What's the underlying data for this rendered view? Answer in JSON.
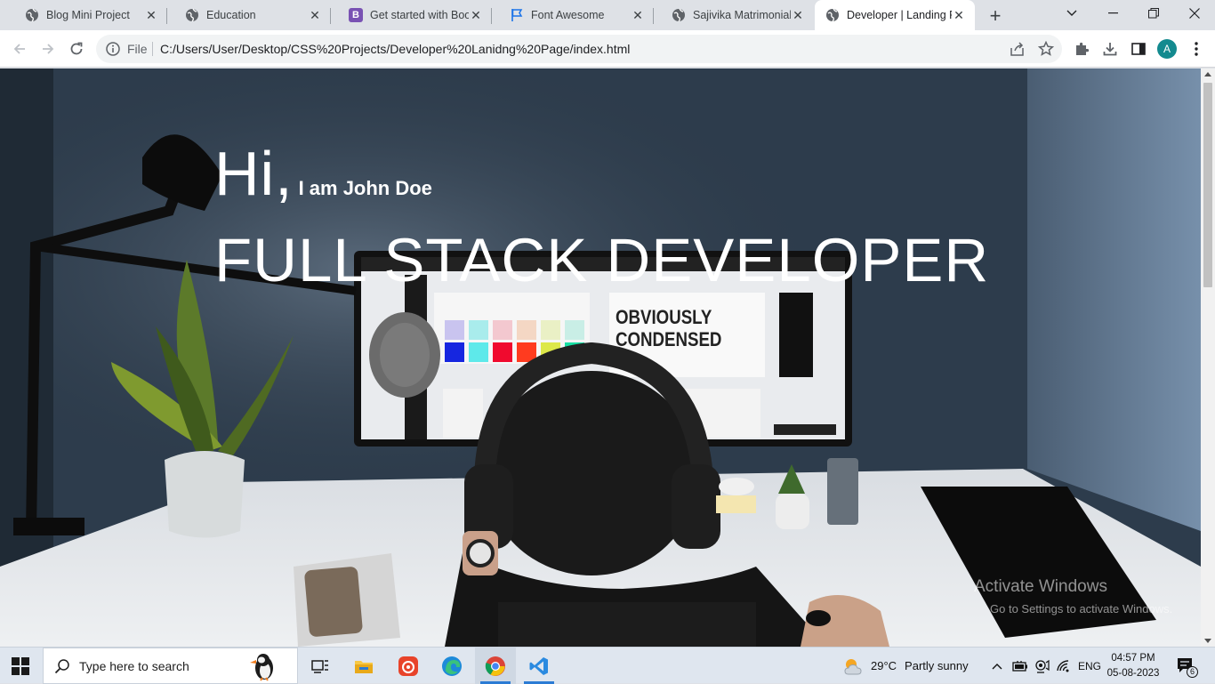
{
  "browser": {
    "tabs": [
      {
        "title": "Blog Mini Project",
        "favicon": "globe-icon"
      },
      {
        "title": "Education",
        "favicon": "globe-icon"
      },
      {
        "title": "Get started with Bootstrap",
        "favicon": "bootstrap-icon"
      },
      {
        "title": "Font Awesome",
        "favicon": "flag-icon"
      },
      {
        "title": "Sajivika Matrimonial Website",
        "favicon": "globe-icon"
      },
      {
        "title": "Developer | Landing Page",
        "favicon": "globe-icon",
        "active": true
      }
    ],
    "omnibox": {
      "scheme_label": "File",
      "url": "C:/Users/User/Desktop/CSS%20Projects/Developer%20Lanidng%20Page/index.html"
    },
    "profile_initial": "A"
  },
  "page": {
    "greeting": "Hi,",
    "name": "I am John Doe",
    "role": "FULL STACK DEVELOPER"
  },
  "watermark": {
    "line1": "Activate Windows",
    "line2": "Go to Settings to activate Windows."
  },
  "taskbar": {
    "search_placeholder": "Type here to search",
    "weather_temp": "29°C",
    "weather_text": "Partly sunny",
    "language": "ENG",
    "time": "04:57 PM",
    "date": "05-08-2023",
    "notifications": "6"
  },
  "colors": {
    "accent": "#1a73e8",
    "hero_text": "#ffffff",
    "profile": "#138a8f"
  }
}
